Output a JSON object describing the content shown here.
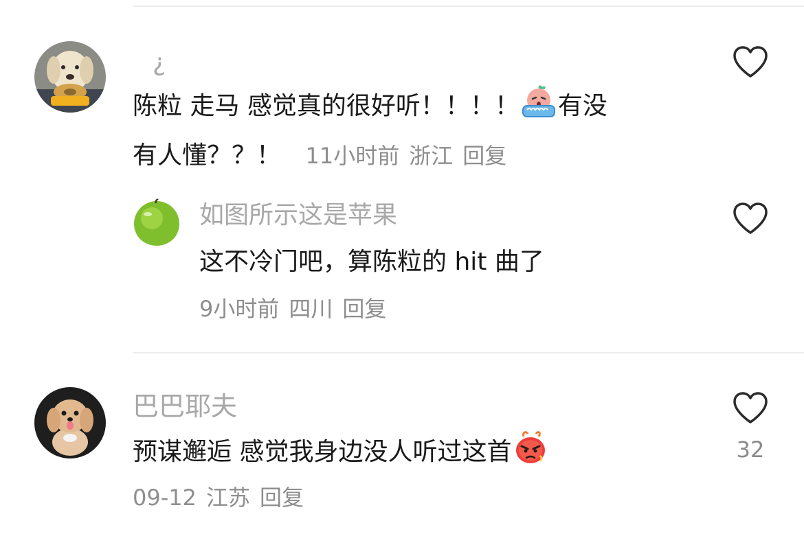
{
  "comments": [
    {
      "username": "¿",
      "text_line1_a": "陈粒 走马 感觉真的很好听！！！！",
      "text_line1_b": "有没",
      "text_line2": "有人懂？？！",
      "time": "11小时前",
      "location": "浙江",
      "reply_label": "回复",
      "emoji": "crying-emoji"
    },
    {
      "username": "如图所示这是苹果",
      "text": "这不冷门吧，算陈粒的 hit 曲了",
      "time": "9小时前",
      "location": "四川",
      "reply_label": "回复"
    },
    {
      "username": "巴巴耶夫",
      "text": "预谋邂逅 感觉我身边没人听过这首",
      "time": "09-12",
      "location": "江苏",
      "reply_label": "回复",
      "likes": "32",
      "emoji": "angry-emoji"
    }
  ],
  "icons": [
    "heart-outline-icon"
  ],
  "colors": {
    "text": "#1a1a1a",
    "username": "#a8a8a8",
    "meta": "#8e8e8e",
    "divider": "#ededed"
  }
}
